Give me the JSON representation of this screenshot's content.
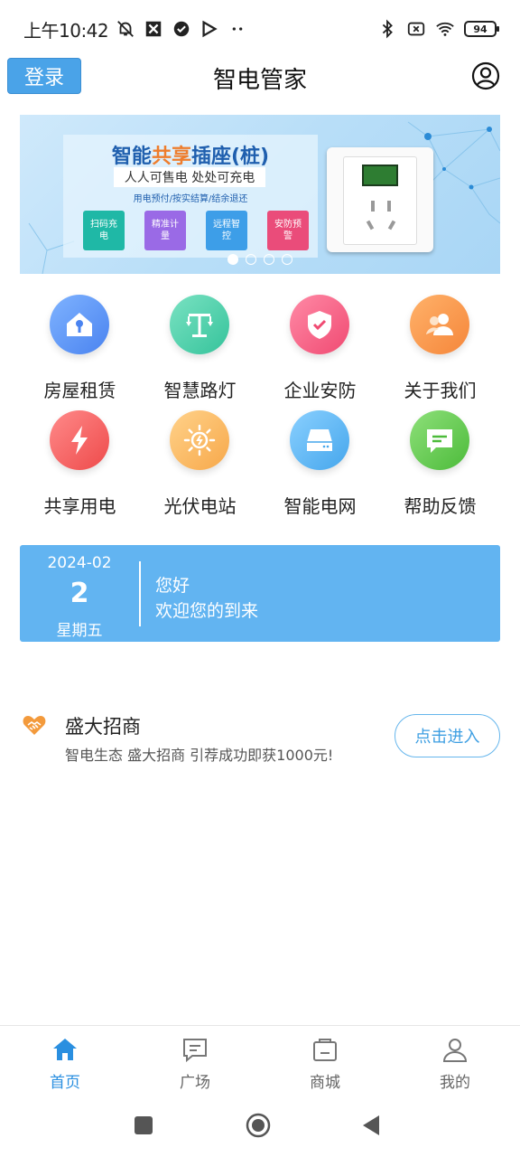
{
  "status_bar": {
    "time": "上午10:42",
    "battery": "94",
    "left_icons": [
      "mute-bell-icon",
      "app-notification-icon",
      "check-circle-icon",
      "play-store-icon",
      "more-dots-icon"
    ],
    "right_icons": [
      "bluetooth-icon",
      "sim-off-icon",
      "wifi-icon",
      "battery-icon"
    ]
  },
  "header": {
    "login_label": "登录",
    "title": "智电管家",
    "profile_icon": "user-circle-icon"
  },
  "banner": {
    "title_part1": "智能",
    "title_highlight": "共享",
    "title_part2": "插座(桩)",
    "subtitle": "人人可售电  处处可充电",
    "subtitle2": "用电预付/按实结算/结余退还",
    "tags": [
      {
        "label": "扫码充电",
        "color": "#1fb8a6"
      },
      {
        "label": "精准计量",
        "color": "#9a6ae6"
      },
      {
        "label": "远程智控",
        "color": "#3d9ee8"
      },
      {
        "label": "安防预警",
        "color": "#ea4c7a"
      }
    ],
    "pages": 4,
    "active_page": 1
  },
  "features": [
    {
      "label": "房屋租赁",
      "icon": "house-key-icon",
      "color_from": "#7fb3ff",
      "color_to": "#4a83f0"
    },
    {
      "label": "智慧路灯",
      "icon": "street-lamp-icon",
      "color_from": "#7ae2c2",
      "color_to": "#35c39b"
    },
    {
      "label": "企业安防",
      "icon": "shield-check-icon",
      "color_from": "#ff8aa6",
      "color_to": "#f04a72"
    },
    {
      "label": "关于我们",
      "icon": "people-icon",
      "color_from": "#ffb26a",
      "color_to": "#f5863a"
    },
    {
      "label": "共享用电",
      "icon": "lightning-icon",
      "color_from": "#ff8a8a",
      "color_to": "#ee4a4a"
    },
    {
      "label": "光伏电站",
      "icon": "sun-icon",
      "color_from": "#ffd28a",
      "color_to": "#f7a84a"
    },
    {
      "label": "智能电网",
      "icon": "server-drive-icon",
      "color_from": "#8ad0ff",
      "color_to": "#45a6ec"
    },
    {
      "label": "帮助反馈",
      "icon": "chat-bubble-icon",
      "color_from": "#8ee07a",
      "color_to": "#4cbb3a"
    }
  ],
  "date_card": {
    "year_month": "2024-02",
    "day": "2",
    "weekday": "星期五",
    "greeting": "您好",
    "welcome": "欢迎您的到来"
  },
  "promo": {
    "icon": "handshake-heart-icon",
    "title": "盛大招商",
    "description": "智电生态 盛大招商 引荐成功即获1000元!",
    "button_label": "点击进入"
  },
  "tabs": [
    {
      "label": "首页",
      "icon": "home-icon",
      "active": true
    },
    {
      "label": "广场",
      "icon": "message-square-icon",
      "active": false
    },
    {
      "label": "商城",
      "icon": "shopping-bag-icon",
      "active": false
    },
    {
      "label": "我的",
      "icon": "user-icon",
      "active": false
    }
  ],
  "colors": {
    "accent": "#4aa3e8",
    "active_tab": "#2a8fe0",
    "date_card": "#62b4f1"
  }
}
